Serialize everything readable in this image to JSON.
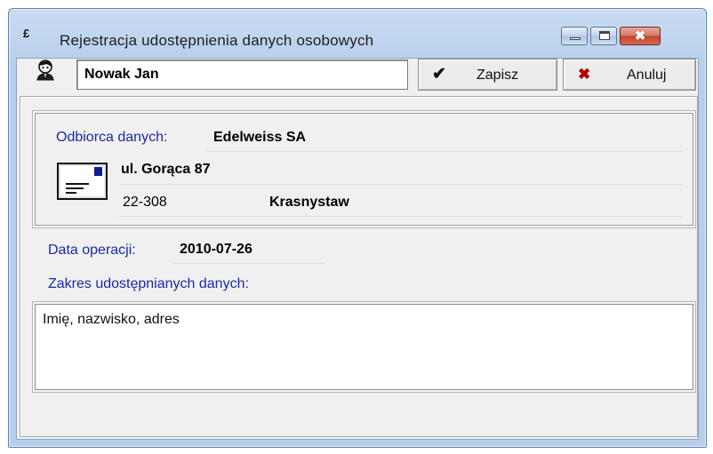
{
  "window": {
    "title": "Rejestracja udostępnienia danych osobowych",
    "title_icon": "£",
    "controls": {
      "minimize": "minimize-icon",
      "maximize": "maximize-icon",
      "close": "✖"
    }
  },
  "header": {
    "person_name": "Nowak Jan",
    "save_label": "Zapisz",
    "save_icon": "✔",
    "cancel_label": "Anuluj",
    "cancel_icon": "✖"
  },
  "recipient": {
    "label": "Odbiorca danych:",
    "name": "Edelweiss SA",
    "street": "ul. Gorąca 87",
    "postal_code": "22-308",
    "city": "Krasnystaw"
  },
  "operation": {
    "date_label": "Data operacji:",
    "date_value": "2010-07-26",
    "scope_label": "Zakres udostępnianych danych:",
    "scope_value": "Imię, nazwisko, adres"
  },
  "colors": {
    "label_blue": "#1a2aa8",
    "close_red": "#c5402a",
    "cancel_red": "#b20000"
  }
}
